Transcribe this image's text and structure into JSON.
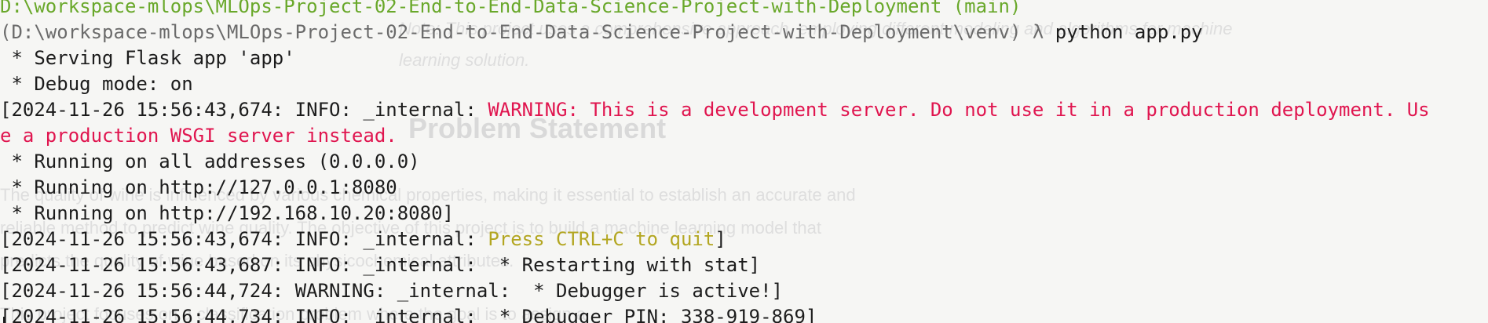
{
  "background_doc": {
    "note_line1": "Note: This project uses a comprehensive approach, employing different modeling and algorithms for machine",
    "note_line2": "learning solution.",
    "heading": "Problem Statement",
    "para_line1": "The quality of wine is influenced by various chemical properties, making it essential to establish an accurate and",
    "para_line2": "reliable method to predict wine quality. The objective of this project is to build a machine learning model that",
    "para_line3": "predicts the quality of wine based on its physicochemical attributes.",
    "para_line4": "This project focuses on a classification problem where the goal is to assign a"
  },
  "terminal": {
    "top_partial": "D:\\workspace-mlops\\MLOps-Project-02-End-to-End-Data-Science-Project-with-Deployment (main)",
    "prompt": "(D:\\workspace-mlops\\MLOps-Project-02-End-to-End-Data-Science-Project-with-Deployment\\venv) λ ",
    "command": "python app.py",
    "serving": " * Serving Flask app 'app'",
    "debug_mode": " * Debug mode: on",
    "log1_prefix": "[2024-11-26 15:56:43,674: INFO: _internal: ",
    "warning_part1": "WARNING: This is a development server. Do not use it in a production deployment. Us",
    "warning_part2": "e a production WSGI server instead.",
    "running_all": " * Running on all addresses (0.0.0.0)",
    "running_local": " * Running on http://127.0.0.1:8080",
    "running_lan": " * Running on http://192.168.10.20:8080]",
    "log2_prefix": "[2024-11-26 15:56:43,674: INFO: _internal: ",
    "quit_msg": "Press CTRL+C to quit",
    "log2_suffix": "]",
    "log3": "[2024-11-26 15:56:43,687: INFO: _internal:  * Restarting with stat]",
    "log4": "[2024-11-26 15:56:44,724: WARNING: _internal:  * Debugger is active!]",
    "log5": "[2024-11-26 15:56:44,734: INFO: _internal:  * Debugger PIN: 338-919-869]"
  },
  "colors": {
    "terminal_text": "#1c1c1c",
    "prompt_path": "#6b6b6b",
    "top_partial": "#69a82a",
    "warning": "#e0154f",
    "quit_hint": "#b3a621"
  }
}
